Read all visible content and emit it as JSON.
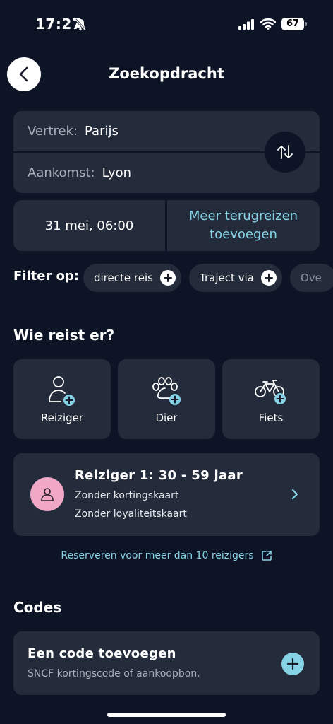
{
  "status_bar": {
    "time": "17:27",
    "battery": "67"
  },
  "header": {
    "title": "Zoekopdracht"
  },
  "route": {
    "departure_label": "Vertrek:",
    "departure_value": "Parijs",
    "arrival_label": "Aankomst:",
    "arrival_value": "Lyon"
  },
  "date": {
    "value": "31 mei, 06:00",
    "return_action": "Meer terugreizen toevoegen"
  },
  "filter": {
    "label": "Filter op:",
    "chips": [
      "directe reis",
      "Traject via",
      "Ove"
    ]
  },
  "travelers": {
    "title": "Wie reist er?",
    "buttons": [
      "Reiziger",
      "Dier",
      "Fiets"
    ]
  },
  "passenger": {
    "title": "Reiziger 1: 30 - 59 jaar",
    "line1": "Zonder kortingskaart",
    "line2": "Zonder loyaliteitskaart"
  },
  "reserve_link": "Reserveren voor meer dan 10 reizigers",
  "codes": {
    "title": "Codes",
    "card_title": "Een code toevoegen",
    "card_subtitle": "SNCF kortingscode of aankoopbon."
  },
  "colors": {
    "background": "#0d1425",
    "card": "#242c3b",
    "accent": "#86d3e6",
    "avatar": "#f1a7c6"
  },
  "icons": [
    "back-arrow-icon",
    "swap-icon",
    "plus-icon",
    "person-add-icon",
    "paw-add-icon",
    "bike-add-icon",
    "person-icon",
    "chevron-right-icon",
    "external-link-icon",
    "bell-slash-icon",
    "signal-icon",
    "wifi-icon"
  ]
}
